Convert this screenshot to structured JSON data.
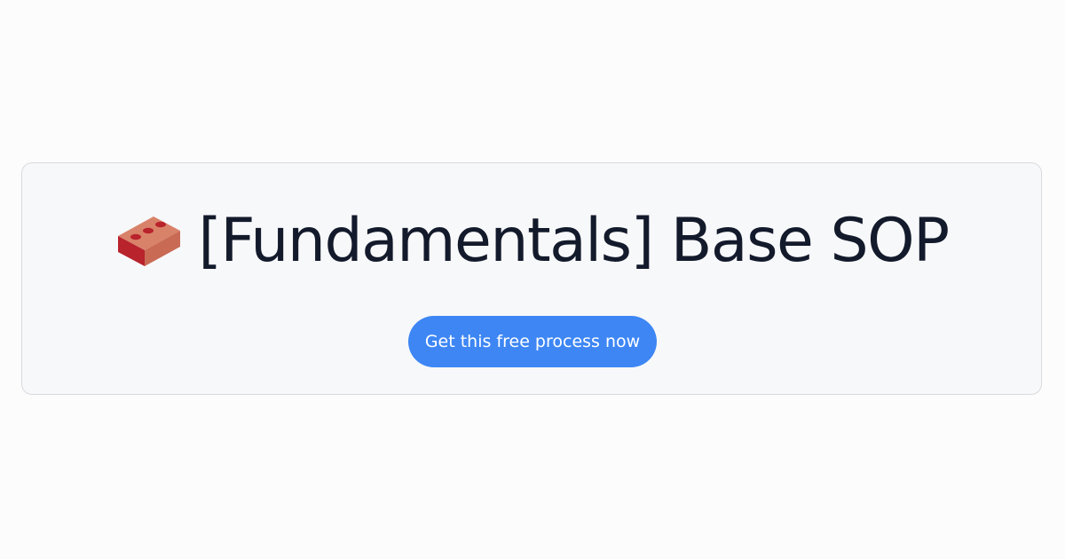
{
  "card": {
    "icon": "brick-icon",
    "title": "[Fundamentals] Base SOP",
    "cta_label": "Get this free process now"
  },
  "colors": {
    "page_bg": "#fcfcfd",
    "card_bg": "#f7f8fa",
    "card_border": "#d9dadd",
    "title_text": "#131a2b",
    "button_bg": "#3d86f4",
    "button_text": "#ffffff",
    "brick_top": "#d9826a",
    "brick_front": "#b8232c",
    "brick_side": "#9a1920"
  }
}
